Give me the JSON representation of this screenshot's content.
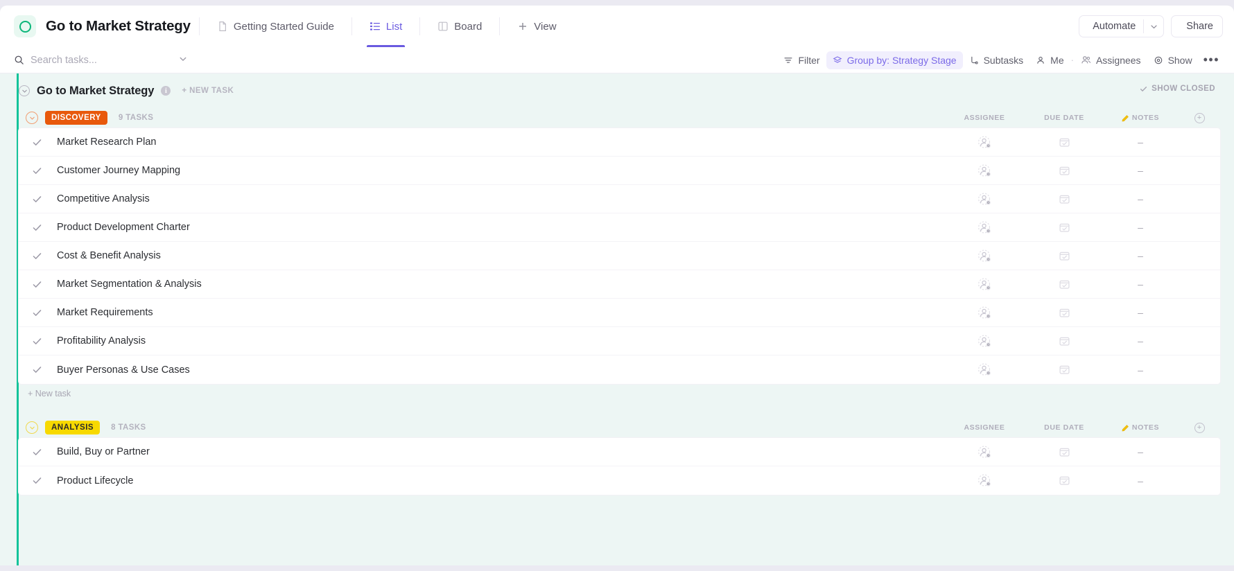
{
  "header": {
    "logo_icon": "clickup-ring-logo",
    "doc_title": "Go to Market Strategy",
    "tabs": [
      {
        "label": "Getting Started Guide",
        "icon": "doc-icon",
        "active": false
      },
      {
        "label": "List",
        "icon": "list-icon",
        "active": true
      },
      {
        "label": "Board",
        "icon": "board-icon",
        "active": false
      },
      {
        "label": "View",
        "icon": "plus-icon",
        "active": false
      }
    ],
    "automate_label": "Automate",
    "automate_icon": "robot-icon",
    "automate_chevron_icon": "chevron-down-icon",
    "share_label": "Share",
    "share_icon": "share-nodes-icon"
  },
  "controls": {
    "search_placeholder": "Search tasks...",
    "search_value": "",
    "search_icon": "search-icon",
    "search_chevron_icon": "chevron-down-icon",
    "filter_label": "Filter",
    "filter_icon": "filter-icon",
    "groupby_label": "Group by: Strategy Stage",
    "groupby_icon": "layers-icon",
    "groupby_accent": "#7b6ae8",
    "groupby_bg": "#f1effd",
    "subtasks_label": "Subtasks",
    "subtasks_icon": "subtask-icon",
    "me_label": "Me",
    "me_icon": "person-icon",
    "separator": "·",
    "assignees_label": "Assignees",
    "assignees_icon": "people-icon",
    "show_label": "Show",
    "show_icon": "eye-icon",
    "more_label": "•••",
    "more_icon": "ellipsis-icon"
  },
  "list": {
    "accent_color": "#14c39a",
    "background": "#edf6f4",
    "collapse_icon": "chevron-down-circle-icon",
    "title": "Go to Market Strategy",
    "info_icon": "info-icon",
    "info_glyph": "i",
    "new_task_label": "+ NEW TASK",
    "show_closed_label": "SHOW CLOSED",
    "show_closed_icon": "check-icon",
    "columns": {
      "assignee": "ASSIGNEE",
      "due_date": "DUE DATE",
      "notes": "NOTES",
      "notes_icon": "pencil-note-icon",
      "add_column_icon": "plus-circle-icon"
    },
    "row_new_task_label": "+ New task",
    "empty_value": "–",
    "check_icon": "check-icon",
    "avatar_icon": "assignee-placeholder-icon",
    "calendar_icon": "calendar-icon",
    "groups": [
      {
        "name": "DISCOVERY",
        "badge_bg": "#e8590c",
        "badge_fg": "#ffffff",
        "ring_color": "#f09e72",
        "task_count": "9 TASKS",
        "tasks": [
          {
            "name": "Market Research Plan",
            "assignee": "",
            "due_date": "",
            "notes": "–"
          },
          {
            "name": "Customer Journey Mapping",
            "assignee": "",
            "due_date": "",
            "notes": "–"
          },
          {
            "name": "Competitive Analysis",
            "assignee": "",
            "due_date": "",
            "notes": "–"
          },
          {
            "name": "Product Development Charter",
            "assignee": "",
            "due_date": "",
            "notes": "–"
          },
          {
            "name": "Cost & Benefit Analysis",
            "assignee": "",
            "due_date": "",
            "notes": "–"
          },
          {
            "name": "Market Segmentation & Analysis",
            "assignee": "",
            "due_date": "",
            "notes": "–"
          },
          {
            "name": "Market Requirements",
            "assignee": "",
            "due_date": "",
            "notes": "–"
          },
          {
            "name": "Profitability Analysis",
            "assignee": "",
            "due_date": "",
            "notes": "–"
          },
          {
            "name": "Buyer Personas & Use Cases",
            "assignee": "",
            "due_date": "",
            "notes": "–"
          }
        ]
      },
      {
        "name": "ANALYSIS",
        "badge_bg": "#f7d900",
        "badge_fg": "#2b2b2b",
        "ring_color": "#f0d84e",
        "task_count": "8 TASKS",
        "tasks": [
          {
            "name": "Build, Buy or Partner",
            "assignee": "",
            "due_date": "",
            "notes": "–"
          },
          {
            "name": "Product Lifecycle",
            "assignee": "",
            "due_date": "",
            "notes": "–"
          }
        ]
      }
    ]
  }
}
